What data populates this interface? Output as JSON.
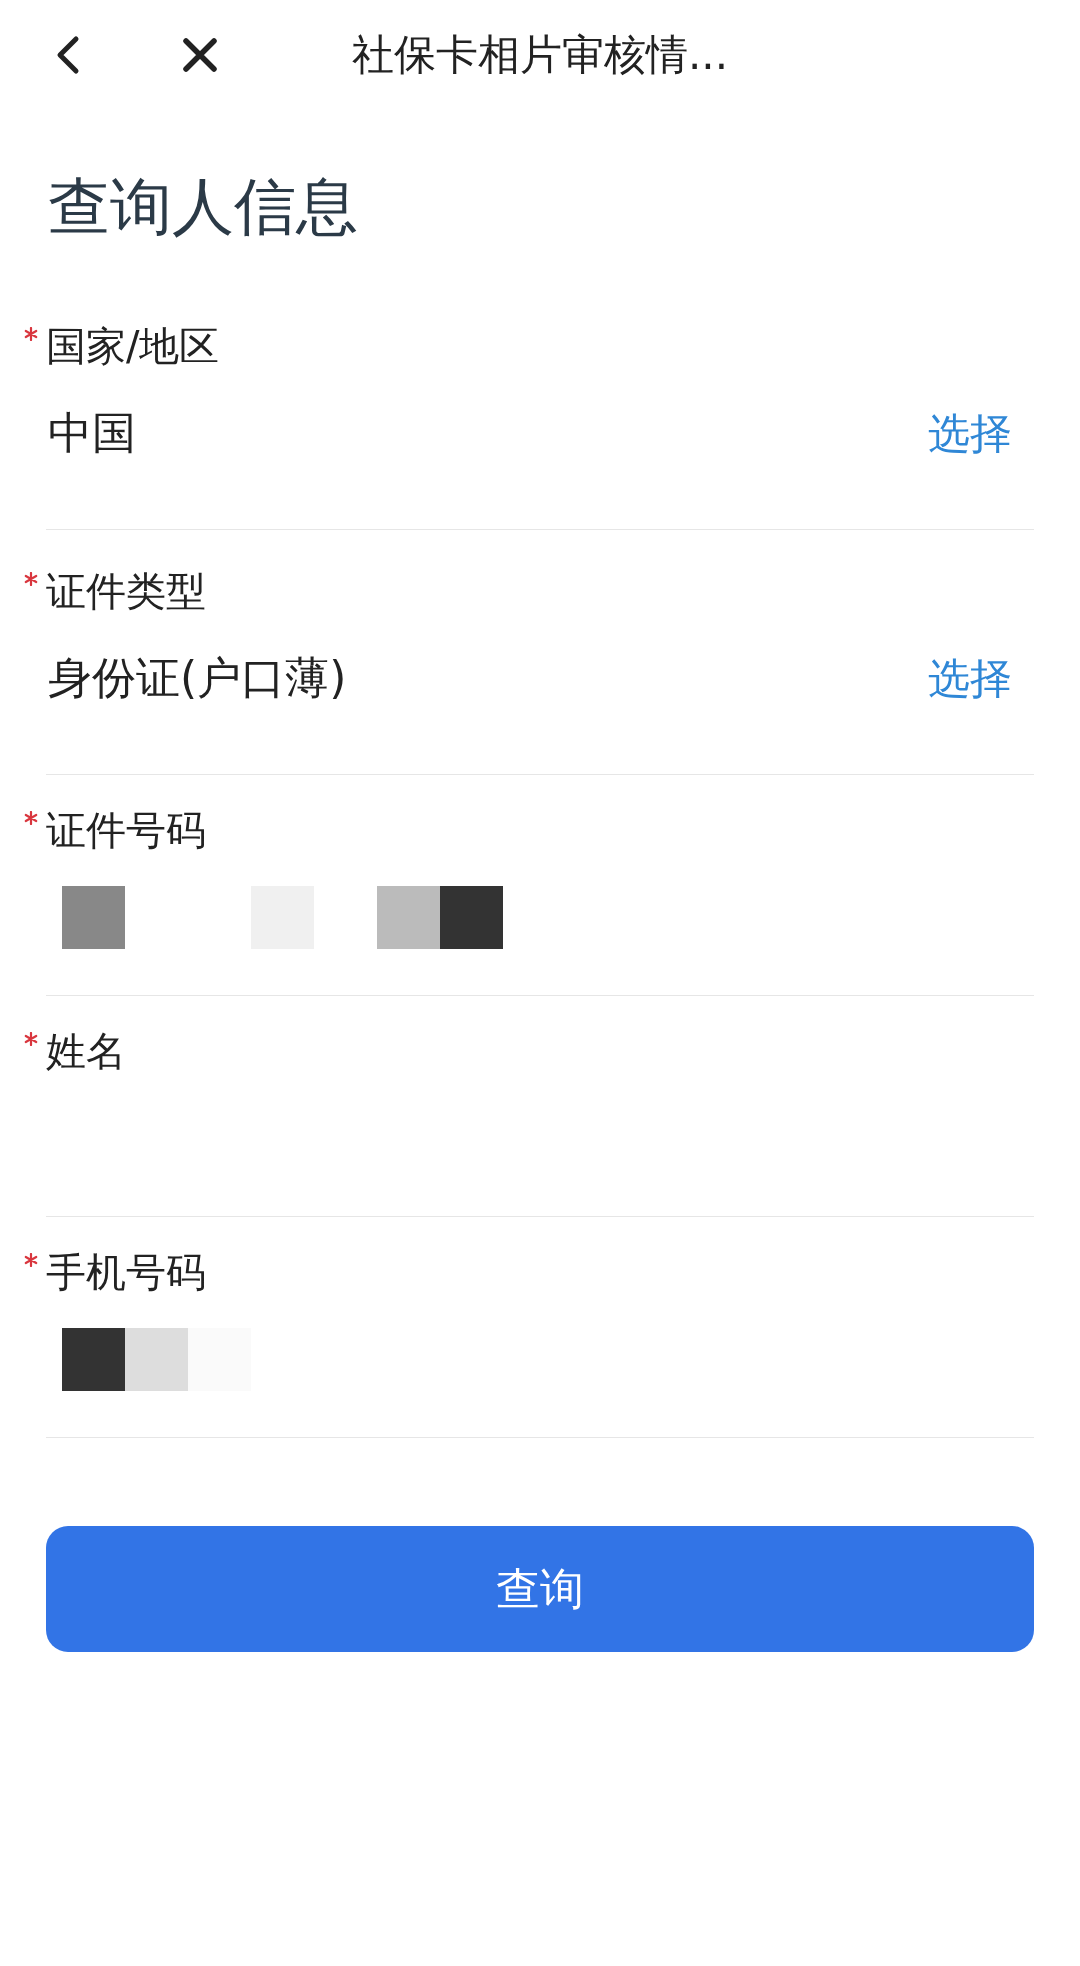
{
  "nav": {
    "title": "社保卡相片审核情..."
  },
  "heading": "查询人信息",
  "fields": [
    {
      "label": "国家/地区",
      "required": true,
      "kind": "select",
      "value": "中国",
      "action": "选择"
    },
    {
      "label": "证件类型",
      "required": true,
      "kind": "select",
      "value": "身份证(户口薄)",
      "action": "选择"
    },
    {
      "label": "证件号码",
      "required": true,
      "kind": "input",
      "redacted": true
    },
    {
      "label": "姓名",
      "required": true,
      "kind": "input",
      "redacted": false
    },
    {
      "label": "手机号码",
      "required": true,
      "kind": "input",
      "redacted": true
    }
  ],
  "submit": "查询"
}
